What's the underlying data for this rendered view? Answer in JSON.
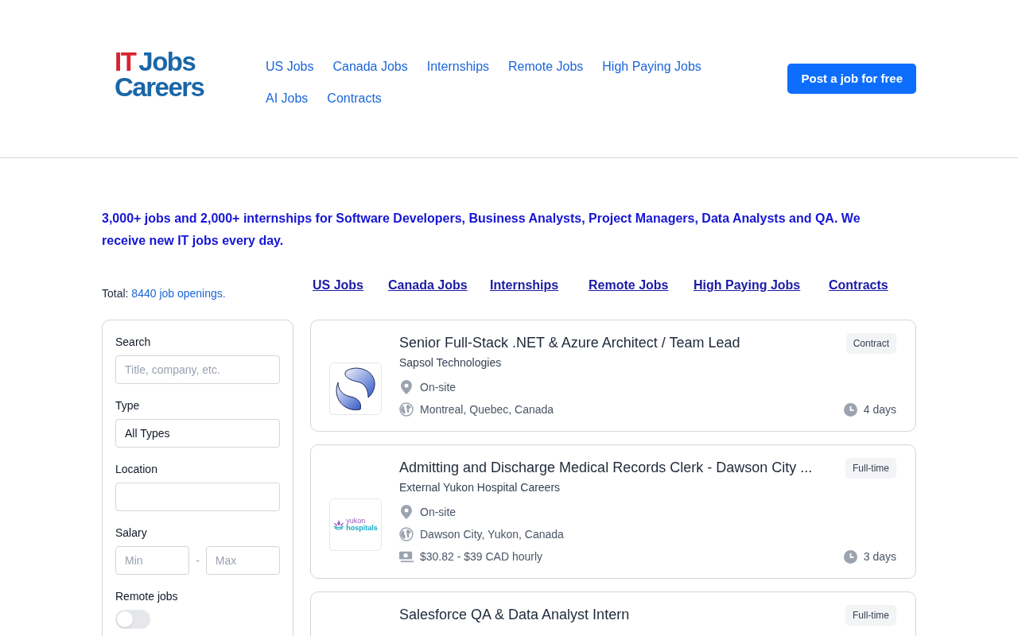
{
  "logo": {
    "line_1a": "IT",
    "line_1b": "Jobs",
    "line_2": "Careers"
  },
  "nav": [
    {
      "label": "US Jobs"
    },
    {
      "label": "Canada Jobs"
    },
    {
      "label": "Internships"
    },
    {
      "label": "Remote Jobs"
    },
    {
      "label": "High Paying Jobs"
    },
    {
      "label": "AI Jobs"
    },
    {
      "label": "Contracts"
    }
  ],
  "post_button": "Post a job for free",
  "intro": "3,000+ jobs and 2,000+ internships for Software Developers, Business Analysts, Project Managers, Data Analysts and QA. We receive new IT jobs every day.",
  "total": {
    "label": "Total:",
    "link": "8440 job openings."
  },
  "quick_links": [
    "US Jobs",
    "Canada Jobs",
    "Internships",
    "Remote Jobs",
    "High Paying Jobs",
    "Contracts"
  ],
  "filters": {
    "search": {
      "label": "Search",
      "placeholder": "Title, company, etc."
    },
    "type": {
      "label": "Type",
      "value": "All Types"
    },
    "location": {
      "label": "Location"
    },
    "salary": {
      "label": "Salary",
      "min_placeholder": "Min",
      "separator": "-",
      "max_placeholder": "Max"
    },
    "remote": {
      "label": "Remote jobs",
      "on": false
    }
  },
  "jobs": [
    {
      "logo": {
        "kind": "swoosh"
      },
      "title": "Senior Full-Stack .NET & Azure Architect / Team Lead",
      "company": "Sapsol Technologies",
      "type": "Contract",
      "workplace": "On-site",
      "location": "Montreal, Quebec, Canada",
      "age": "4 days"
    },
    {
      "logo": {
        "kind": "hospital",
        "text": [
          "yukon",
          "hospitals"
        ]
      },
      "title": "Admitting and Discharge Medical Records Clerk - Dawson City ...",
      "company": "External Yukon Hospital Careers",
      "type": "Full-time",
      "workplace": "On-site",
      "location": "Dawson City, Yukon, Canada",
      "salary": "$30.82 - $39 CAD hourly",
      "age": "3 days"
    },
    {
      "title": "Salesforce QA & Data Analyst Intern",
      "type": "Full-time"
    }
  ]
}
